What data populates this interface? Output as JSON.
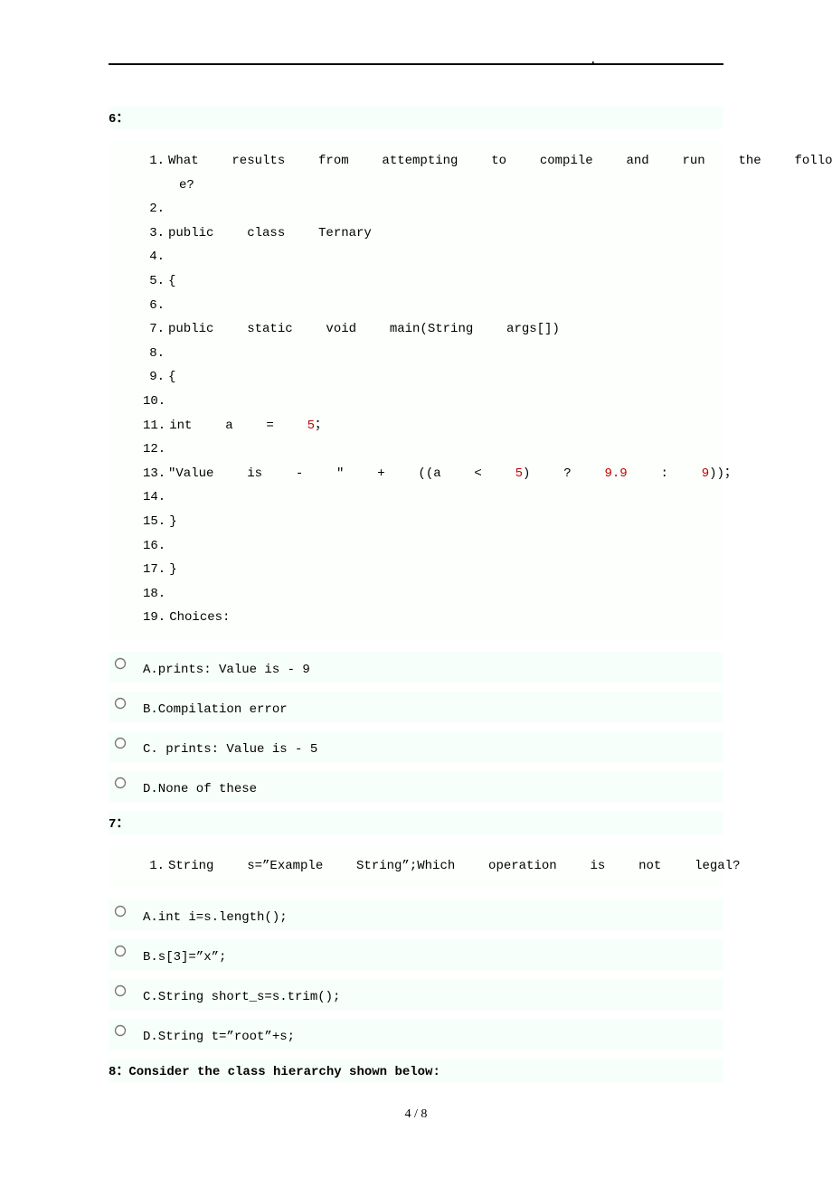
{
  "q6": {
    "label": "6：",
    "code": [
      {
        "n": "1.",
        "text": "What  results  from  attempting  to  compile  and  run  the  following  cod",
        "spaced": true
      },
      {
        "n": "",
        "text": "e?",
        "spaced": false,
        "wrap": true
      },
      {
        "n": "2.",
        "text": "",
        "spaced": false
      },
      {
        "n": "3.",
        "text": "public  class  Ternary",
        "spaced": true
      },
      {
        "n": "4.",
        "text": "",
        "spaced": false
      },
      {
        "n": "5.",
        "text": "{",
        "spaced": false
      },
      {
        "n": "6.",
        "text": "",
        "spaced": false
      },
      {
        "n": "7.",
        "text": "public  static  void  main(String  args[])",
        "spaced": true
      },
      {
        "n": "8.",
        "text": "",
        "spaced": false
      },
      {
        "n": "9.",
        "text": "{",
        "spaced": false
      },
      {
        "n": "10.",
        "text": "",
        "spaced": false
      },
      {
        "n": "11.",
        "text": "int  a  =  ",
        "spaced": true,
        "suffix_num": "5",
        "suffix_after": "；"
      },
      {
        "n": "12.",
        "text": "",
        "spaced": false
      },
      {
        "n": "13.",
        "text": "\"Value  is  -  \"  +  ((a  <  ",
        "spaced": true,
        "mid_num": "5",
        "mid_after": ")  ?  ",
        "mid_num2": "9.9",
        "mid_after2": "  :  ",
        "mid_num3": "9",
        "mid_after3": "))；"
      },
      {
        "n": "14.",
        "text": "",
        "spaced": false
      },
      {
        "n": "15.",
        "text": "}",
        "spaced": false
      },
      {
        "n": "16.",
        "text": "",
        "spaced": false
      },
      {
        "n": "17.",
        "text": "}",
        "spaced": false
      },
      {
        "n": "18.",
        "text": "",
        "spaced": false
      },
      {
        "n": "19.",
        "text": "Choices:",
        "spaced": false
      }
    ],
    "choices": [
      "A.prints: Value is - 9",
      "B.Compilation error",
      "C. prints: Value is - 5",
      "D.None of these"
    ]
  },
  "q7": {
    "label": "7：",
    "code": [
      {
        "n": "1.",
        "text": "String  s=”Example  String”;Which  operation  is  not  legal?",
        "spaced": true
      }
    ],
    "choices": [
      "A.int i=s.length();",
      "B.s[3]=”x”;",
      "C.String short_s=s.trim();",
      "D.String t=”root”+s;"
    ]
  },
  "q8": {
    "label": "8：Consider the class hierarchy shown below:"
  },
  "footer": "4 / 8"
}
